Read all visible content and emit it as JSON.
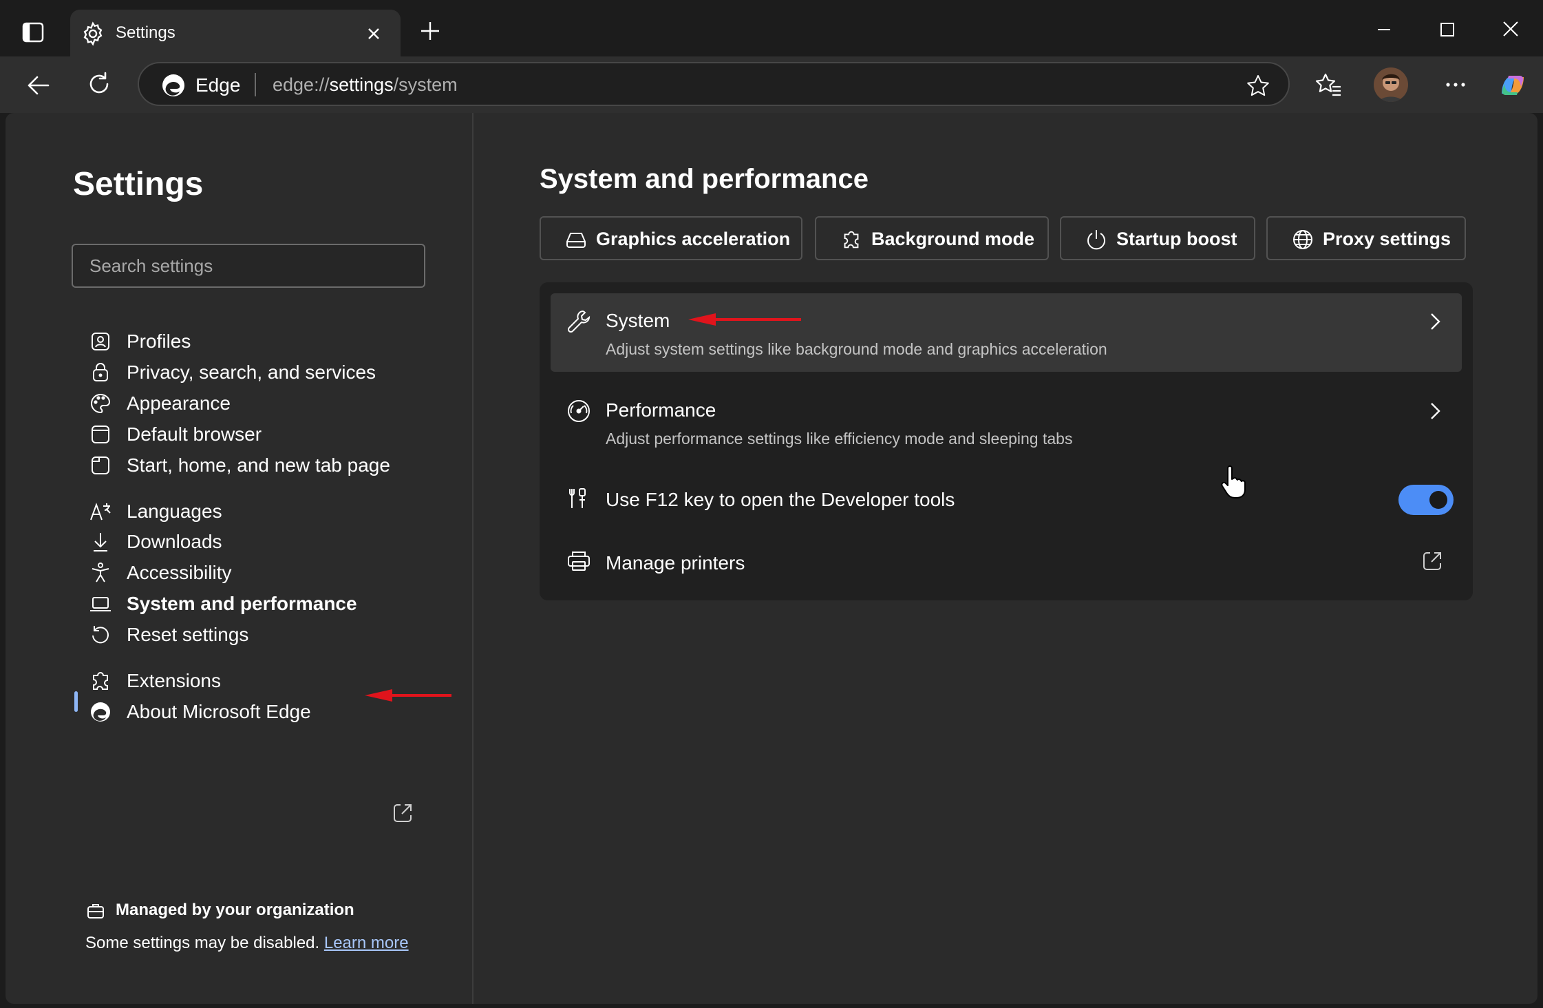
{
  "browser": {
    "tab": {
      "title": "Settings",
      "icon": "gear-icon",
      "close_icon": "close-icon"
    },
    "new_tab_icon": "plus-icon",
    "window_controls": [
      "minimize-icon",
      "maximize-icon",
      "close-icon"
    ],
    "address_bar": {
      "brand": "Edge",
      "url_prefix": "edge://",
      "url_host": "settings",
      "url_path": "/system"
    },
    "toolbar_icons": [
      "back-icon",
      "refresh-icon",
      "star-icon",
      "favorites-icon",
      "avatar",
      "more-icon",
      "copilot-icon"
    ]
  },
  "sidebar": {
    "title": "Settings",
    "search_placeholder": "Search settings",
    "groups": [
      [
        {
          "label": "Profiles",
          "icon": "profile-icon"
        },
        {
          "label": "Privacy, search, and services",
          "icon": "lock-icon"
        },
        {
          "label": "Appearance",
          "icon": "palette-icon"
        },
        {
          "label": "Default browser",
          "icon": "browser-icon"
        },
        {
          "label": "Start, home, and new tab page",
          "icon": "home-tab-icon"
        }
      ],
      [
        {
          "label": "Languages",
          "icon": "languages-icon"
        },
        {
          "label": "Downloads",
          "icon": "download-icon"
        },
        {
          "label": "Accessibility",
          "icon": "accessibility-icon"
        },
        {
          "label": "System and performance",
          "icon": "laptop-icon",
          "active": true
        },
        {
          "label": "Reset settings",
          "icon": "reset-icon"
        }
      ],
      [
        {
          "label": "Extensions",
          "icon": "puzzle-icon",
          "external": true
        },
        {
          "label": "About Microsoft Edge",
          "icon": "edge-logo-icon"
        }
      ]
    ],
    "managed": {
      "label": "Managed by your organization",
      "note": "Some settings may be disabled.",
      "link": "Learn more"
    }
  },
  "content": {
    "title": "System and performance",
    "quick_links": [
      {
        "label": "Graphics acceleration",
        "icon": "drive-icon"
      },
      {
        "label": "Background mode",
        "icon": "puzzle-icon"
      },
      {
        "label": "Startup boost",
        "icon": "power-icon"
      },
      {
        "label": "Proxy settings",
        "icon": "globe-icon"
      }
    ],
    "rows": {
      "system": {
        "title": "System",
        "description": "Adjust system settings like background mode and graphics acceleration",
        "icon": "wrench-icon"
      },
      "performance": {
        "title": "Performance",
        "description": "Adjust performance settings like efficiency mode and sleeping tabs",
        "icon": "performance-icon"
      },
      "f12": {
        "title": "Use F12 key to open the Developer tools",
        "icon": "tools-icon",
        "enabled": true
      },
      "printers": {
        "title": "Manage printers",
        "icon": "printer-icon"
      }
    }
  },
  "colors": {
    "accent": "#4c8df6",
    "annotation_arrow": "#e0141c",
    "link": "#a8c7fa"
  }
}
